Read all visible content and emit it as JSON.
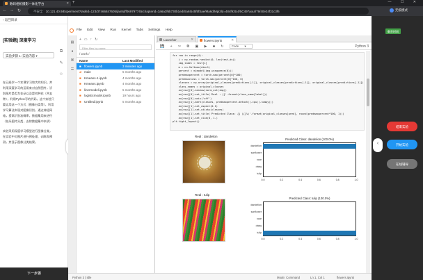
{
  "browser": {
    "tab_title": "数码相机摄影一体化学台",
    "omnibox_security": "不安全",
    "url": "10.121.40.9/Experiment?taskId=123/37466847605/jan8d/f069797745/chapterId=3a6a3f6b730b1ed/Sa6Ib45f5fSae/Ma6d/Mpi3ld=484f93tc4/5C497aout/79/40e24f31c3f6",
    "profile": "无痕模式",
    "controls": "— ☐ ✕"
  },
  "left_panel": {
    "top_label": "返回目录",
    "title": "[实验题] 深度学习",
    "select": "实验步骤 1: 实验内容",
    "paragraph1": "在已经学一个本课学习和大的知识。并利用深度学习的运用来对自然图片，识别图片是否为花朵以及是何种花（共五种），利用Python写的代码，这个实验只要运用这一个方式（图像分类等），利用学习算法实现对图像识别，通过神经网络，提高识别准确率，数据集用来进行（花朵图片分类，去除数据集中杂质）",
    "paragraph2": "实验采用深度学习模型进行图像分类，在实验中对图片进行预处理、训练和预测，并显示图像分类结果。",
    "bottom_button": "下一步骤"
  },
  "jupyter": {
    "menu": [
      "File",
      "Edit",
      "View",
      "Run",
      "Kernel",
      "Tabs",
      "Settings",
      "Help"
    ],
    "filter_placeholder": "Filter files by name",
    "breadcrumb": "/ work /",
    "col_name": "Name",
    "col_modified": "Last Modified",
    "files": [
      {
        "name": "flowers.ipynb",
        "modified": "3 minutes ago",
        "selected": true
      },
      {
        "name": "main",
        "modified": "5 months ago"
      },
      {
        "name": "Kmeans-1.ipynb",
        "modified": "4 months ago"
      },
      {
        "name": "Kmeans.ipynb",
        "modified": "4 months ago"
      },
      {
        "name": "linermodel.ipynb",
        "modified": "5 months ago"
      },
      {
        "name": "logisticmodel.ipynb",
        "modified": "19 hours ago"
      },
      {
        "name": "Untitled.ipynb",
        "modified": "5 months ago"
      }
    ],
    "tabs": [
      "Launcher",
      "flowers.ipynb"
    ],
    "cell_type": "Code",
    "kernel": "Python 3",
    "code_lines": [
      "for row in range(4):",
      "    i = np.random.randint(0, len(test_ds))",
      "    img,label = test[i]",
      "",
      "    m = nn.Softmax(dim=1)",
      "    percent = m(model(img.unsqueeze(0)))",
      "    predmaxpercent = torch.max(percent[0]*100)",
      "    predmaxclass = torch.max(percent[0]*100, 0)",
      "    classes = np.array(original_classes[predictions[-1]], original_classes[predictions[-1]], original_classes[predictions[-1]])",
      "    class_names = original_classes",
      "",
      "    ax[row][0].imshow(norm_out(img))",
      "    ax[row][0].set_title('Real : {}'.format(class_name[label]))",
      "    ax[row][0].axis('off')",
      "    ax[row][1].barh(classes, predmaxpercent.detach().cpu().numpy())",
      "    ax[row][1].set_aspect(0.1)",
      "    ax[row][1].set_yticks(classes)",
      "    ax[row][1].set_title('Predicted Class: {} ({}%)'.format(original_classes[pred], round(predmaxpercent*100, 1)))",
      "    ax[row][1].set_xlim(0, 1.)",
      "plt.tight_layout()"
    ],
    "statusbar": {
      "left": "Python 3 | Idle",
      "mode": "Mode: Command",
      "position": "Ln 1, Col 1",
      "file": "flowers.ipynb"
    }
  },
  "outputs": [
    {
      "real_label": "Real : dandelion",
      "photo": "dandelion"
    },
    {
      "real_label": "Real : tulip",
      "photo": "tulip"
    }
  ],
  "chart_data": [
    {
      "type": "bar",
      "orientation": "horizontal",
      "title": "Predicted Class: dandelion (100.0%)",
      "categories": [
        "dandelion",
        "sunflower",
        "rose",
        "daisy",
        "tulip"
      ],
      "values": [
        1.0,
        0.0,
        0.0,
        0.0,
        0.0
      ],
      "xlim": [
        0,
        1.0
      ],
      "xticks": [
        "0.0",
        "0.2",
        "0.4",
        "0.6",
        "0.8",
        "1.0"
      ]
    },
    {
      "type": "bar",
      "orientation": "horizontal",
      "title": "Predicted Class: tulip (100.0%)",
      "categories": [
        "dandelion",
        "sunflower",
        "rose",
        "daisy",
        "tulip"
      ],
      "values": [
        0.0,
        0.0,
        0.0,
        0.0,
        1.0
      ],
      "xlim": [
        0,
        1.0
      ],
      "xticks": [
        "0.0",
        "0.2",
        "0.4",
        "0.6",
        "0.8",
        "1.0"
      ]
    }
  ],
  "right_panel": {
    "timer": "剩余时间",
    "btn_end": "结束实验",
    "btn_open": "开始实验",
    "btn_online": "在线辅导"
  }
}
